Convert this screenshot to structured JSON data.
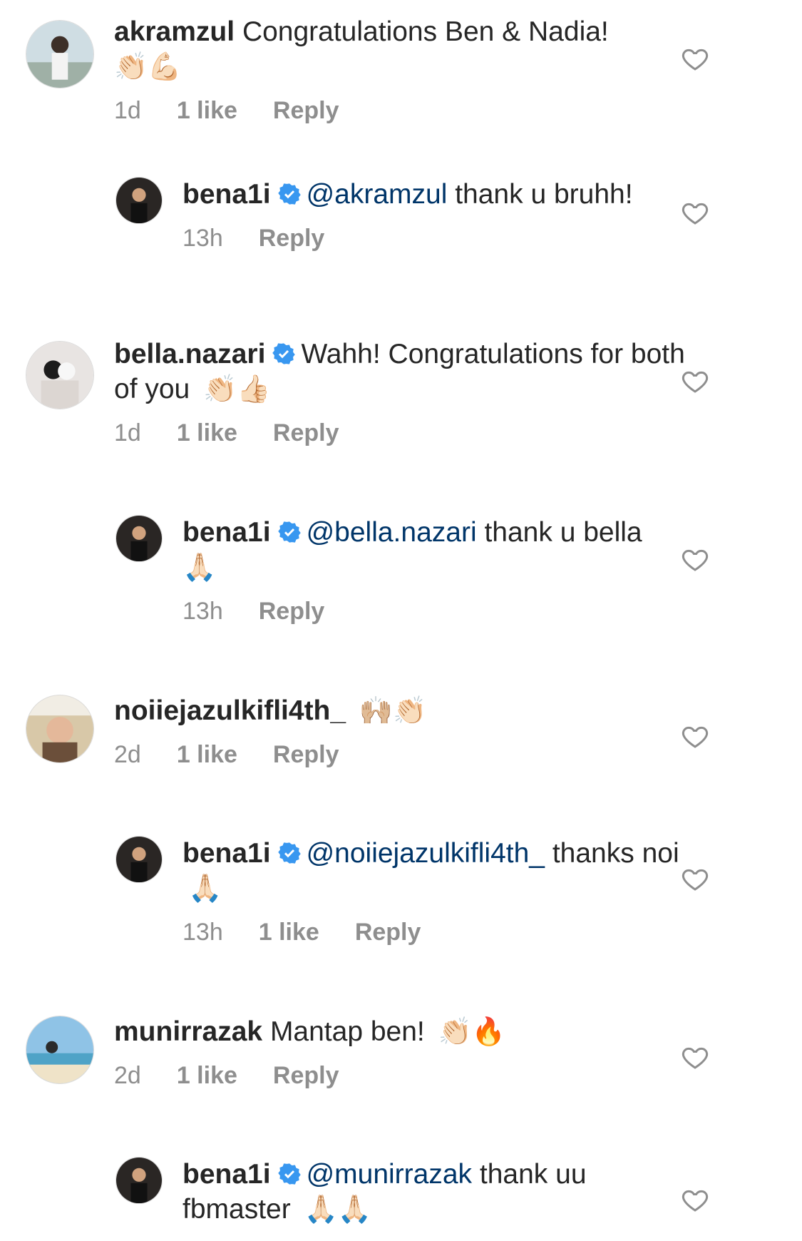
{
  "comments": [
    {
      "username": "akramzul",
      "verified": false,
      "mention": "",
      "text": "Congratulations Ben & Nadia!",
      "emoji": "👏🏻💪🏻",
      "time": "1d",
      "likes": "1 like",
      "reply_label": "Reply",
      "is_reply": false
    },
    {
      "username": "bena1i",
      "verified": true,
      "mention": "@akramzul",
      "text": "thank u bruhh!",
      "emoji": "",
      "time": "13h",
      "likes": "",
      "reply_label": "Reply",
      "is_reply": true
    },
    {
      "username": "bella.nazari",
      "verified": true,
      "mention": "",
      "text": "Wahh! Congratulations for both of you",
      "emoji": "👏🏻👍🏻",
      "time": "1d",
      "likes": "1 like",
      "reply_label": "Reply",
      "is_reply": false
    },
    {
      "username": "bena1i",
      "verified": true,
      "mention": "@bella.nazari",
      "text": "thank u bella",
      "emoji": "🙏🏻",
      "time": "13h",
      "likes": "",
      "reply_label": "Reply",
      "is_reply": true
    },
    {
      "username": "noiiejazulkifli4th_",
      "verified": false,
      "mention": "",
      "text": "",
      "emoji": "🙌🏼👏🏻",
      "time": "2d",
      "likes": "1 like",
      "reply_label": "Reply",
      "is_reply": false
    },
    {
      "username": "bena1i",
      "verified": true,
      "mention": "@noiiejazulkifli4th_",
      "text": "thanks noi",
      "emoji": "🙏🏻",
      "time": "13h",
      "likes": "1 like",
      "reply_label": "Reply",
      "is_reply": true
    },
    {
      "username": "munirrazak",
      "verified": false,
      "mention": "",
      "text": "Mantap ben!",
      "emoji": "👏🏻🔥",
      "time": "2d",
      "likes": "1 like",
      "reply_label": "Reply",
      "is_reply": false
    },
    {
      "username": "bena1i",
      "verified": true,
      "mention": "@munirrazak",
      "text": "thank uu fbmaster",
      "emoji": "🙏🏻🙏🏻",
      "time": "",
      "likes": "",
      "reply_label": "",
      "is_reply": true
    }
  ],
  "colors": {
    "text": "#262626",
    "secondary": "#8e8e8e",
    "mention": "#003569",
    "verified": "#3897f0"
  },
  "icons": {
    "like": "heart-outline-icon",
    "verified": "verified-badge-icon"
  }
}
